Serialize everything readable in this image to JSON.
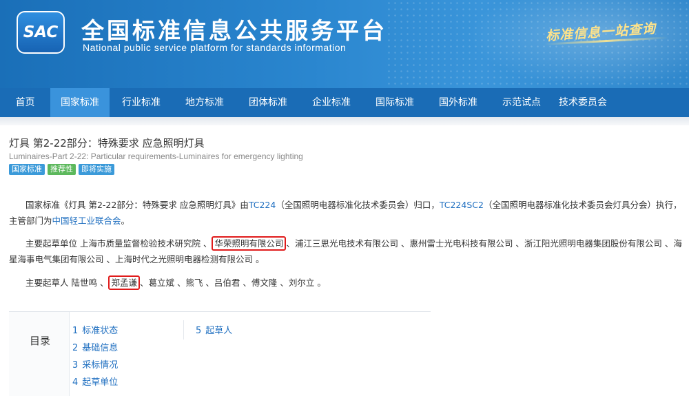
{
  "header": {
    "logo_text": "SAC",
    "title": "全国标准信息公共服务平台",
    "subtitle": "National public service platform  for standards information",
    "slogan": "标准信息一站查询"
  },
  "nav": {
    "items": [
      {
        "label": "首页"
      },
      {
        "label": "国家标准"
      },
      {
        "label": "行业标准"
      },
      {
        "label": "地方标准"
      },
      {
        "label": "团体标准"
      },
      {
        "label": "企业标准"
      },
      {
        "label": "国际标准"
      },
      {
        "label": "国外标准"
      },
      {
        "label": "示范试点"
      },
      {
        "label": "技术委员会"
      }
    ],
    "active": "国家标准"
  },
  "standard": {
    "title": "灯具 第2-22部分：特殊要求 应急照明灯具",
    "title_en": "Luminaires-Part 2-22: Particular requirements-Luminaires for emergency lighting",
    "badges": [
      {
        "label": "国家标准",
        "color": "#3b9ad9"
      },
      {
        "label": "推荐性",
        "color": "#5cb85c"
      },
      {
        "label": "即将实施",
        "color": "#3b9ad9"
      }
    ]
  },
  "intro": {
    "p1_a": "国家标准《灯具 第2-22部分：特殊要求 应急照明灯具》由",
    "p1_tc1": "TC224",
    "p1_b": "（全国照明电器标准化技术委员会）归口，",
    "p1_tc2": "TC224SC2",
    "p1_c": "（全国照明电器标准化技术委员会灯具分会）执行，主管部门为",
    "p1_dept": "中国轻工业联合会",
    "p1_d": "。",
    "p2_a": "主要起草单位 上海市质量监督检验技术研究院 、",
    "p2_boxed": "华荣照明有限公司",
    "p2_b": "、浦江三思光电技术有限公司 、惠州雷士光电科技有限公司 、浙江阳光照明电器集团股份有限公司 、海星海事电气集团有限公司 、上海时代之光照明电器检测有限公司 。",
    "p3_a": "主要起草人 陆世鸣 、",
    "p3_boxed": "郑孟谦",
    "p3_b": "、葛立斌 、熊飞 、吕伯君 、傅文隆 、刘尔立 。"
  },
  "toc": {
    "label": "目录",
    "items": [
      {
        "num": "1",
        "label": "标准状态"
      },
      {
        "num": "2",
        "label": "基础信息"
      },
      {
        "num": "3",
        "label": "采标情况"
      },
      {
        "num": "4",
        "label": "起草单位"
      },
      {
        "num": "5",
        "label": "起草人"
      }
    ]
  },
  "colors": {
    "banner": "#1a6fb8",
    "nav": "#1a6cb6",
    "nav_active": "#3a93dc",
    "link": "#1f6fc0",
    "highlight_box": "#e01b1b"
  }
}
